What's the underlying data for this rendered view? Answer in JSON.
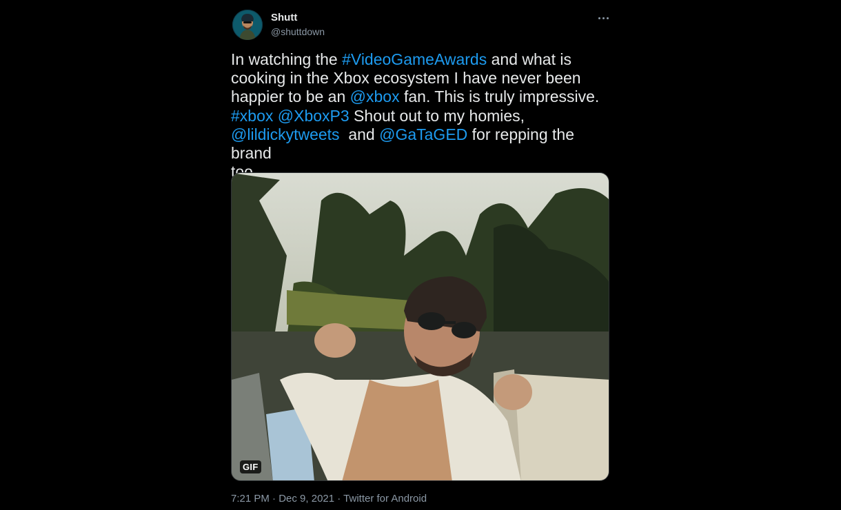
{
  "tweet": {
    "author": {
      "name": "Shutt",
      "handle": "@shuttdown"
    },
    "text_segments": [
      {
        "t": "In watching the ",
        "link": false
      },
      {
        "t": "#VideoGameAwards",
        "link": true
      },
      {
        "t": " and what is\ncooking in the Xbox ecosystem I have never been\nhappier to be an ",
        "link": false
      },
      {
        "t": "@xbox",
        "link": true
      },
      {
        "t": " fan. This is truly impressive.\n",
        "link": false
      },
      {
        "t": "#xbox",
        "link": true
      },
      {
        "t": " ",
        "link": false
      },
      {
        "t": "@XboxP3",
        "link": true
      },
      {
        "t": " Shout out to my homies,\n",
        "link": false
      },
      {
        "t": "@lildickytweets",
        "link": true
      },
      {
        "t": "  and ",
        "link": false
      },
      {
        "t": "@GaTaGED",
        "link": true
      },
      {
        "t": " for repping the brand\ntoo.",
        "link": false
      }
    ],
    "media": {
      "badge": "GIF"
    },
    "meta": {
      "time": "7:21 PM",
      "separator": " · ",
      "date": "Dec 9, 2021",
      "source": "Twitter for Android"
    }
  },
  "colors": {
    "background": "#000000",
    "text": "#e7e9ea",
    "link": "#1d9bf0",
    "secondary": "#8b98a5"
  },
  "icons": {
    "more": "more-horizontal-icon"
  }
}
